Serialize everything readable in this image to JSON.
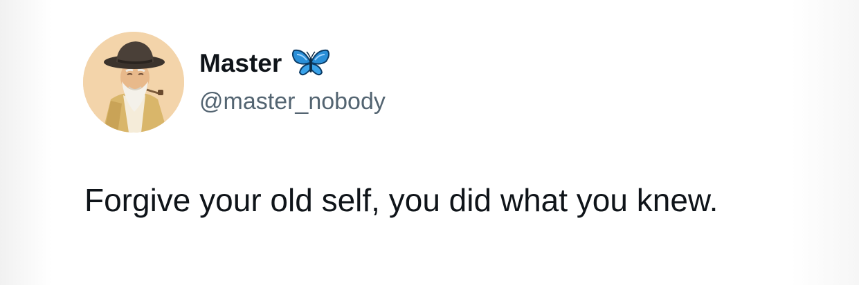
{
  "tweet": {
    "author": {
      "display_name": "Master",
      "handle": "@master_nobody",
      "emoji_icon": "butterfly-icon",
      "avatar": "avatar-illustration-old-man-with-hat"
    },
    "text": "Forgive your old self, you did what you knew."
  },
  "colors": {
    "background": "#ffffff",
    "name_text": "#0f1419",
    "handle_text": "#536471",
    "body_text": "#0f1419",
    "butterfly_blue": "#2a8fd8"
  }
}
